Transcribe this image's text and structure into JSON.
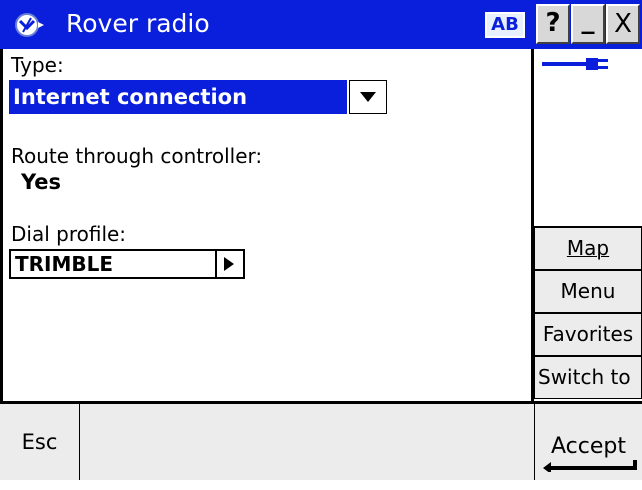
{
  "title_bar": {
    "title": "Rover radio",
    "ab_label": "AB",
    "help_label": "?",
    "minimize_label": "_",
    "close_label": "X"
  },
  "form": {
    "type_label": "Type:",
    "type_value": "Internet connection",
    "route_label": "Route through controller:",
    "route_value": "Yes",
    "dial_label": "Dial profile:",
    "dial_value": "TRIMBLE"
  },
  "side_buttons": {
    "map": "Map",
    "menu": "Menu",
    "favorites": "Favorites",
    "switch_to": "Switch to"
  },
  "bottom_bar": {
    "esc": "Esc",
    "accept": "Accept"
  },
  "colors": {
    "title_bar": "#0a1fdc",
    "selection": "#0a1fdc"
  }
}
